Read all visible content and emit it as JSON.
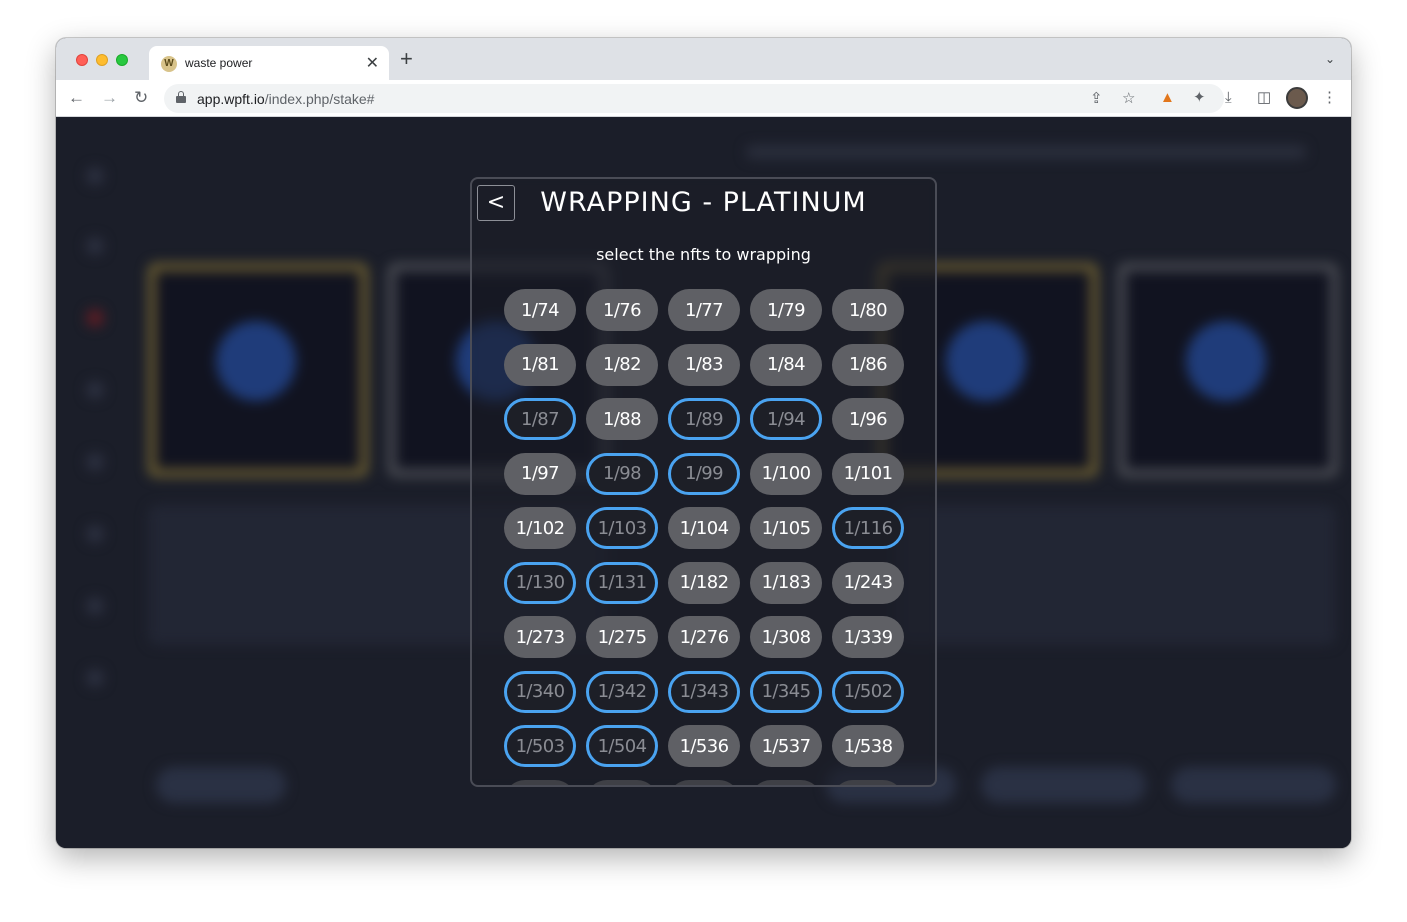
{
  "browser": {
    "tab_title": "waste power",
    "tab_favicon": "W",
    "tab_close": "✕",
    "new_tab": "+",
    "url_host": "app.wpft.io",
    "url_path": "/index.php/stake#"
  },
  "modal": {
    "back_label": "<",
    "title": "WRAPPING - PLATINUM",
    "subtitle": "select the nfts to wrapping",
    "accent_color": "#4aa3f0",
    "nfts": [
      {
        "label": "1/74",
        "selected": false
      },
      {
        "label": "1/76",
        "selected": false
      },
      {
        "label": "1/77",
        "selected": false
      },
      {
        "label": "1/79",
        "selected": false
      },
      {
        "label": "1/80",
        "selected": false
      },
      {
        "label": "1/81",
        "selected": false
      },
      {
        "label": "1/82",
        "selected": false
      },
      {
        "label": "1/83",
        "selected": false
      },
      {
        "label": "1/84",
        "selected": false
      },
      {
        "label": "1/86",
        "selected": false
      },
      {
        "label": "1/87",
        "selected": true
      },
      {
        "label": "1/88",
        "selected": false
      },
      {
        "label": "1/89",
        "selected": true
      },
      {
        "label": "1/94",
        "selected": true
      },
      {
        "label": "1/96",
        "selected": false
      },
      {
        "label": "1/97",
        "selected": false
      },
      {
        "label": "1/98",
        "selected": true
      },
      {
        "label": "1/99",
        "selected": true
      },
      {
        "label": "1/100",
        "selected": false
      },
      {
        "label": "1/101",
        "selected": false
      },
      {
        "label": "1/102",
        "selected": false
      },
      {
        "label": "1/103",
        "selected": true
      },
      {
        "label": "1/104",
        "selected": false
      },
      {
        "label": "1/105",
        "selected": false
      },
      {
        "label": "1/116",
        "selected": true
      },
      {
        "label": "1/130",
        "selected": true
      },
      {
        "label": "1/131",
        "selected": true
      },
      {
        "label": "1/182",
        "selected": false
      },
      {
        "label": "1/183",
        "selected": false
      },
      {
        "label": "1/243",
        "selected": false
      },
      {
        "label": "1/273",
        "selected": false
      },
      {
        "label": "1/275",
        "selected": false
      },
      {
        "label": "1/276",
        "selected": false
      },
      {
        "label": "1/308",
        "selected": false
      },
      {
        "label": "1/339",
        "selected": false
      },
      {
        "label": "1/340",
        "selected": true
      },
      {
        "label": "1/342",
        "selected": true
      },
      {
        "label": "1/343",
        "selected": true
      },
      {
        "label": "1/345",
        "selected": true
      },
      {
        "label": "1/502",
        "selected": true
      },
      {
        "label": "1/503",
        "selected": true
      },
      {
        "label": "1/504",
        "selected": true
      },
      {
        "label": "1/536",
        "selected": false
      },
      {
        "label": "1/537",
        "selected": false
      },
      {
        "label": "1/538",
        "selected": false
      }
    ]
  }
}
